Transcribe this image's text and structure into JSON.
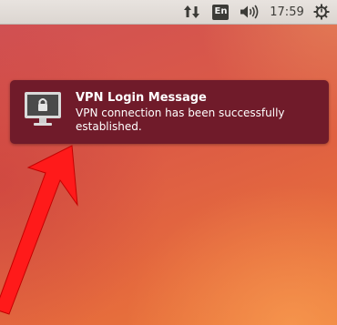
{
  "topbar": {
    "network_icon": "network-transfer-icon",
    "keyboard_layout": "En",
    "volume_icon": "speaker-volume-icon",
    "clock": "17:59",
    "system_icon": "power-gear-icon"
  },
  "notification": {
    "icon": "vpn-monitor-lock-icon",
    "title": "VPN Login Message",
    "body": "VPN connection has been successfully established."
  },
  "annotation": {
    "arrow_color": "#ff1a1a"
  },
  "colors": {
    "notification_bg": "#701b2a",
    "topbar_bg": "#dcd6d1"
  }
}
